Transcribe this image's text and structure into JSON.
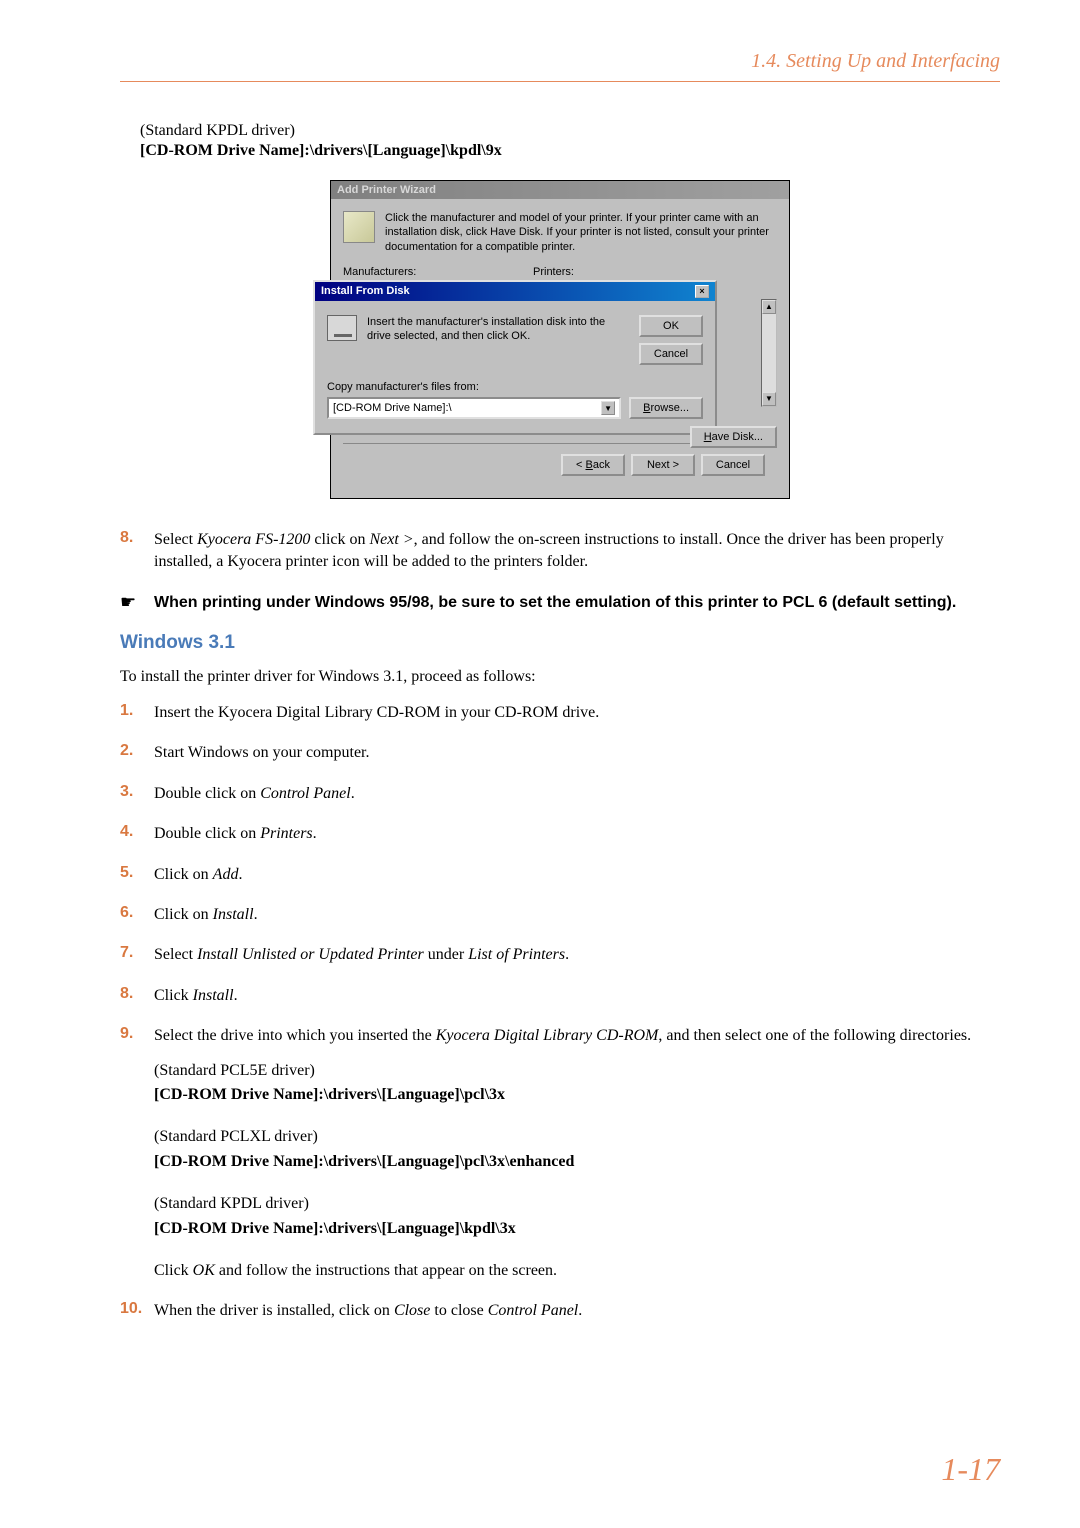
{
  "header": {
    "section": "1.4. Setting Up and Interfacing"
  },
  "topDriver": {
    "label": "(Standard KPDL driver)",
    "path": "[CD-ROM Drive Name]:\\drivers\\[Language]\\kpdl\\9x"
  },
  "dialog": {
    "title": "Add Printer Wizard",
    "intro": "Click the manufacturer and model of your printer. If your printer came with an installation disk, click Have Disk. If your printer is not listed, consult your printer documentation for a compatible printer.",
    "manufacturersLabel": "Manufacturers:",
    "printersLabel": "Printers:",
    "subTitle": "Install From Disk",
    "subText": "Insert the manufacturer's installation disk into the drive selected, and then click OK.",
    "ok": "OK",
    "cancel": "Cancel",
    "copyLabel": "Copy manufacturer's files from:",
    "pathValue": "[CD-ROM Drive Name]:\\",
    "browse": "Browse...",
    "haveDisk": "Have Disk...",
    "back": "< Back",
    "next": "Next >",
    "cancelBtn": "Cancel",
    "backU": "B",
    "haveDiskU": "H",
    "browseU": "B"
  },
  "step8": {
    "num": "8.",
    "prefix": "Select ",
    "model": "Kyocera FS-1200",
    "mid1": " click on ",
    "next": "Next >",
    "rest": ", and follow the on-screen instructions to install. Once the driver has been properly installed, a Kyocera printer icon will be added to the printers folder."
  },
  "note": {
    "text": "When printing under Windows 95/98, be sure to set the emulation of this printer to PCL 6 (default setting)."
  },
  "win31": {
    "heading": "Windows 3.1",
    "intro": "To install the printer driver for Windows 3.1, proceed as follows:",
    "steps": {
      "s1": {
        "num": "1.",
        "text": "Insert the Kyocera Digital Library CD-ROM in your CD-ROM drive."
      },
      "s2": {
        "num": "2.",
        "text": "Start Windows on your computer."
      },
      "s3": {
        "num": "3.",
        "prefix": "Double click on ",
        "em": "Control Panel",
        "suffix": "."
      },
      "s4": {
        "num": "4.",
        "prefix": "Double click on ",
        "em": "Printers",
        "suffix": "."
      },
      "s5": {
        "num": "5.",
        "prefix": "Click on ",
        "em": "Add",
        "suffix": "."
      },
      "s6": {
        "num": "6.",
        "prefix": "Click on ",
        "em": "Install",
        "suffix": "."
      },
      "s7": {
        "num": "7.",
        "prefix": "Select ",
        "em1": "Install Unlisted or Updated Printer",
        "mid": " under ",
        "em2": "List of Printers",
        "suffix": "."
      },
      "s8": {
        "num": "8.",
        "prefix": "Click ",
        "em": "Install",
        "suffix": "."
      },
      "s9": {
        "num": "9.",
        "prefix": "Select the drive into which you inserted the ",
        "em": "Kyocera Digital Library CD-ROM",
        "suffix": ", and then select one of the following directories.",
        "d1label": "(Standard PCL5E driver)",
        "d1path": "[CD-ROM Drive Name]:\\drivers\\[Language]\\pcl\\3x",
        "d2label": "(Standard PCLXL driver)",
        "d2path": "[CD-ROM Drive Name]:\\drivers\\[Language]\\pcl\\3x\\enhanced",
        "d3label": "(Standard KPDL driver)",
        "d3path": "[CD-ROM Drive Name]:\\drivers\\[Language]\\kpdl\\3x",
        "clickPrefix": "Click ",
        "clickEm": "OK",
        "clickSuffix": " and follow the instructions that appear on the screen."
      },
      "s10": {
        "num": "10.",
        "prefix": "When the driver is installed, click on ",
        "em1": "Close",
        "mid": " to close ",
        "em2": "Control Panel",
        "suffix": "."
      }
    }
  },
  "pageNumber": "1-17"
}
